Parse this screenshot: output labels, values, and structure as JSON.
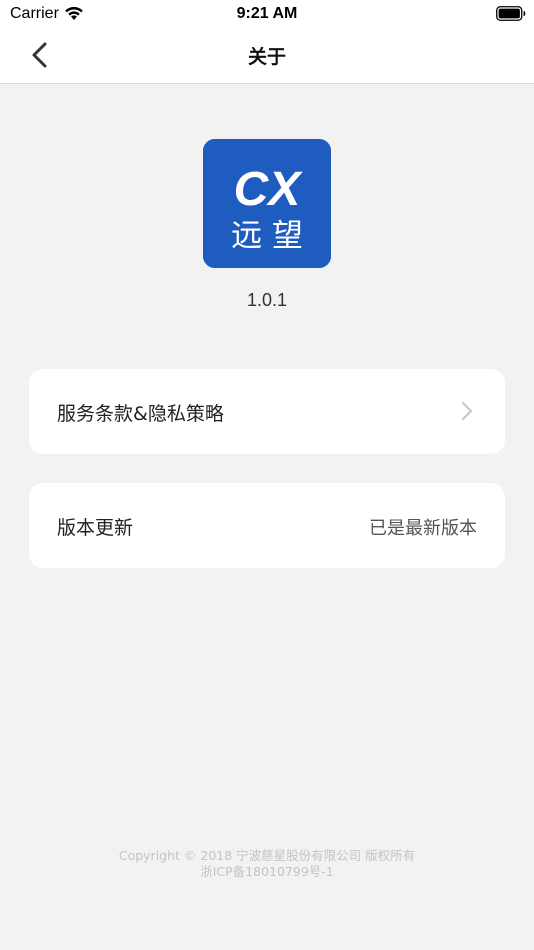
{
  "status_bar": {
    "carrier": "Carrier",
    "time": "9:21 AM"
  },
  "nav": {
    "title": "关于",
    "back_icon": "chevron-left-icon"
  },
  "app": {
    "logo_text_top": "CX",
    "logo_text_bottom": "远 望",
    "logo_color": "#1f5cbf",
    "version": "1.0.1"
  },
  "menu": {
    "terms_label": "服务条款&隐私策略",
    "update_label": "版本更新",
    "update_status": "已是最新版本"
  },
  "footer": {
    "copyright": "Copyright © 2018  宁波慈星股份有限公司  版权所有",
    "icp": "浙ICP备18010799号-1"
  },
  "colors": {
    "background": "#f2f2f2",
    "card": "#ffffff",
    "accent": "#1f5cbf"
  }
}
